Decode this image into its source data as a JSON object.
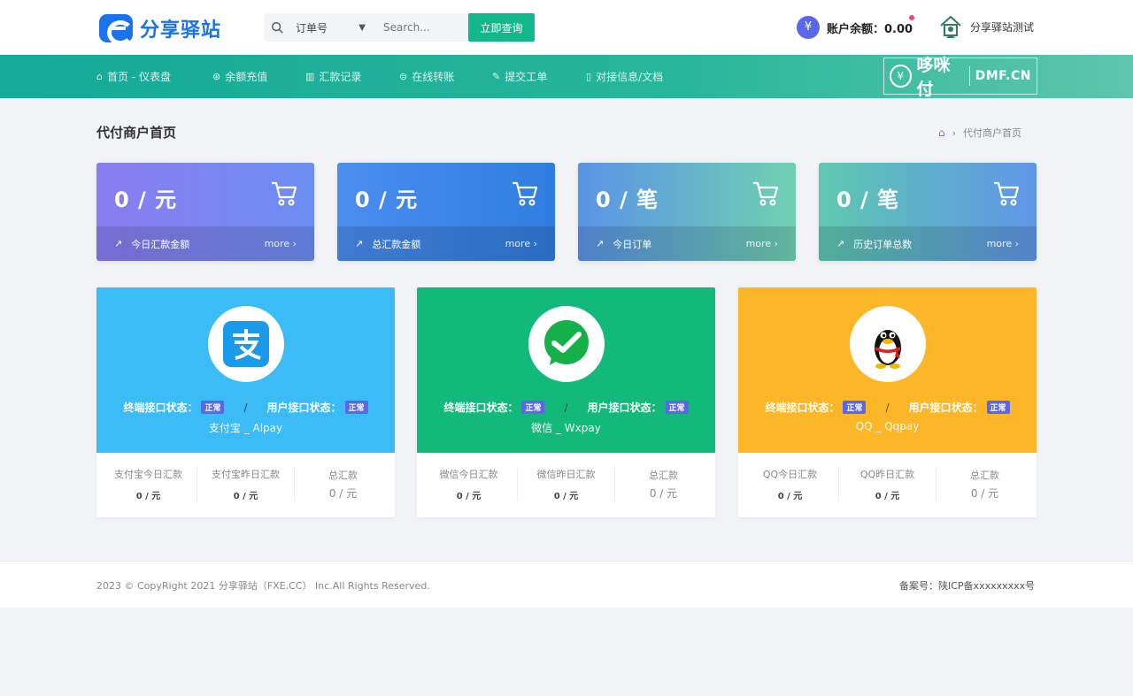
{
  "header": {
    "logo_text": "分享驿站",
    "search": {
      "select_value": "订单号",
      "placeholder": "Search...",
      "button_label": "立即查询"
    },
    "balance_label": "账户余额：0.00",
    "user_name": "分享驿站测试"
  },
  "nav": {
    "items": [
      {
        "icon": "home-icon",
        "label": "首页 - 仪表盘"
      },
      {
        "icon": "recharge-icon",
        "label": "余额充值"
      },
      {
        "icon": "chart-icon",
        "label": "汇款记录"
      },
      {
        "icon": "transfer-icon",
        "label": "在线转账"
      },
      {
        "icon": "edit-icon",
        "label": "提交工单"
      },
      {
        "icon": "doc-icon",
        "label": "对接信息/文档"
      }
    ],
    "brand_cn": "哆咪付",
    "brand_en": "DMF.CN"
  },
  "page": {
    "title": "代付商户首页",
    "breadcrumb": "代付商户首页"
  },
  "stats": [
    {
      "value": "0 / 元",
      "label": "今日汇款金额",
      "more": "more"
    },
    {
      "value": "0 / 元",
      "label": "总汇款金额",
      "more": "more"
    },
    {
      "value": "0 / 笔",
      "label": "今日订单",
      "more": "more"
    },
    {
      "value": "0 / 笔",
      "label": "历史订单总数",
      "more": "more"
    }
  ],
  "pay_channels": [
    {
      "icon": "alipay-icon",
      "terminal_label": "终端接口状态：",
      "terminal_badge": "正常",
      "user_label": "用户接口状态：",
      "user_badge": "正常",
      "name": "支付宝 _ Alpay",
      "stats": [
        {
          "label": "支付宝今日汇款",
          "value": "0 / 元"
        },
        {
          "label": "支付宝昨日汇款",
          "value": "0 / 元"
        },
        {
          "label": "总汇款",
          "value": "0 / 元"
        }
      ]
    },
    {
      "icon": "wechat-icon",
      "terminal_label": "终端接口状态：",
      "terminal_badge": "正常",
      "user_label": "用户接口状态：",
      "user_badge": "正常",
      "name": "微信 _ Wxpay",
      "stats": [
        {
          "label": "微信今日汇款",
          "value": "0 / 元"
        },
        {
          "label": "微信昨日汇款",
          "value": "0 / 元"
        },
        {
          "label": "总汇款",
          "value": "0 / 元"
        }
      ]
    },
    {
      "icon": "qq-icon",
      "terminal_label": "终端接口状态：",
      "terminal_badge": "正常",
      "user_label": "用户接口状态：",
      "user_badge": "正常",
      "name": "QQ _ Qqpay",
      "stats": [
        {
          "label": "QQ今日汇款",
          "value": "0 / 元"
        },
        {
          "label": "QQ昨日汇款",
          "value": "0 / 元"
        },
        {
          "label": "总汇款",
          "value": "0 / 元"
        }
      ]
    }
  ],
  "footer": {
    "copyright": "2023 © CopyRight 2021 分享驿站（FXE.CC） Inc.All Rights Reserved.",
    "icp": "备案号：陕ICP备xxxxxxxxx号"
  },
  "colors": {
    "accent": "#13b88a",
    "alipay": "#3cbcf6",
    "wechat": "#13b97b",
    "qq": "#fcb728",
    "badge": "#5b67e6"
  }
}
